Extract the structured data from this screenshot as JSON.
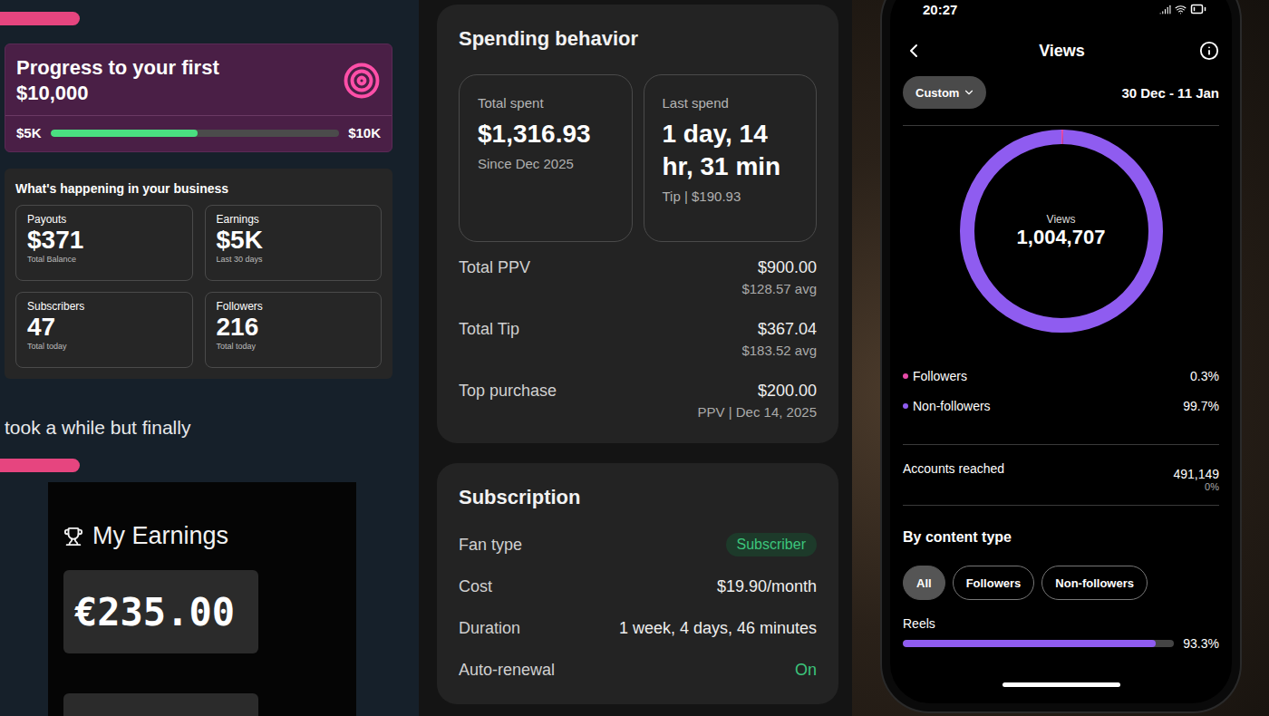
{
  "left_post": {
    "progress_card": {
      "title": "Progress to your first $10,000",
      "start": "$5K",
      "end": "$10K",
      "level": 0.51
    },
    "business_card": {
      "title": "What's happening in your business",
      "stats": [
        {
          "label": "Payouts",
          "value": "$371",
          "sub": "Total Balance"
        },
        {
          "label": "Earnings",
          "value": "$5K",
          "sub": "Last 30 days"
        },
        {
          "label": "Subscribers",
          "value": "47",
          "sub": "Total today"
        },
        {
          "label": "Followers",
          "value": "216",
          "sub": "Total today"
        }
      ]
    },
    "caption": "took a while but finally",
    "earnings_card": {
      "title": "My Earnings",
      "amount": "€235.00"
    }
  },
  "spending": {
    "title": "Spending behavior",
    "boxes": [
      {
        "label": "Total spent",
        "value": "$1,316.93",
        "sub": "Since Dec 2025"
      },
      {
        "label": "Last spend",
        "value": "1 day, 14 hr, 31 min",
        "sub": "Tip | $190.93"
      }
    ],
    "rows": [
      {
        "label": "Total PPV",
        "value": "$900.00",
        "sub": "$128.57 avg"
      },
      {
        "label": "Total Tip",
        "value": "$367.04",
        "sub": "$183.52 avg"
      },
      {
        "label": "Top purchase",
        "value": "$200.00",
        "sub": "PPV | Dec 14, 2025"
      }
    ]
  },
  "subscription": {
    "title": "Subscription",
    "rows": [
      {
        "label": "Fan type",
        "value": "Subscriber",
        "kind": "badge"
      },
      {
        "label": "Cost",
        "value": "$19.90/month",
        "kind": "text"
      },
      {
        "label": "Duration",
        "value": "1 week, 4 days, 46 minutes",
        "kind": "text"
      },
      {
        "label": "Auto-renewal",
        "value": "On",
        "kind": "status"
      }
    ]
  },
  "phone": {
    "status_bar": {
      "time": "20:27"
    },
    "title": "Views",
    "filter": "Custom",
    "date_range": "30 Dec - 11 Jan",
    "ring": {
      "label": "Views",
      "value": "1,004,707"
    },
    "legend": [
      {
        "label": "Followers",
        "value": "0.3%",
        "share": 0.003,
        "color": "#e64aa8"
      },
      {
        "label": "Non-followers",
        "value": "99.7%",
        "share": 0.997,
        "color": "#8f5cf0"
      }
    ],
    "accounts_reached": {
      "label": "Accounts reached",
      "value": "491,149",
      "change": "0%"
    },
    "by_content_type": {
      "title": "By content type",
      "tabs": [
        {
          "label": "All",
          "selected": true
        },
        {
          "label": "Followers",
          "selected": false
        },
        {
          "label": "Non-followers",
          "selected": false
        }
      ],
      "rows": [
        {
          "label": "Reels",
          "value": "93.3%",
          "level": 0.933
        }
      ]
    }
  }
}
